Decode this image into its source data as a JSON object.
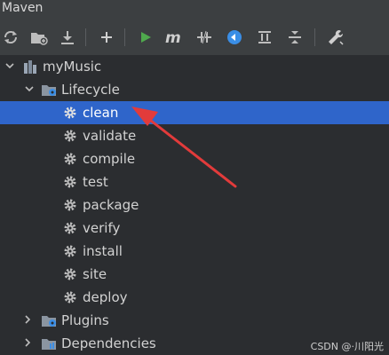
{
  "window": {
    "title": "Maven"
  },
  "toolbar": {
    "buttons": [
      {
        "name": "reload-icon"
      },
      {
        "name": "add-project-icon"
      },
      {
        "name": "download-icon"
      },
      {
        "name": "plus-icon"
      },
      {
        "name": "run-icon"
      },
      {
        "name": "execute-goal-icon"
      },
      {
        "name": "toggle-offline-icon"
      },
      {
        "name": "skip-tests-icon"
      },
      {
        "name": "show-dependencies-icon"
      },
      {
        "name": "collapse-all-icon"
      },
      {
        "name": "settings-icon"
      }
    ]
  },
  "tree": {
    "project": "myMusic",
    "lifecycle": {
      "label": "Lifecycle",
      "goals": [
        "clean",
        "validate",
        "compile",
        "test",
        "package",
        "verify",
        "install",
        "site",
        "deploy"
      ],
      "selected": "clean"
    },
    "plugins": "Plugins",
    "dependencies": "Dependencies"
  },
  "watermark": "CSDN @·川阳光",
  "colors": {
    "background": "#2b2d30",
    "toolbar": "#3c3f41",
    "selection": "#2f65ca",
    "annotation_arrow": "#e23b3b",
    "run_green": "#4fa94d",
    "blue_circle": "#3a8ee6"
  }
}
